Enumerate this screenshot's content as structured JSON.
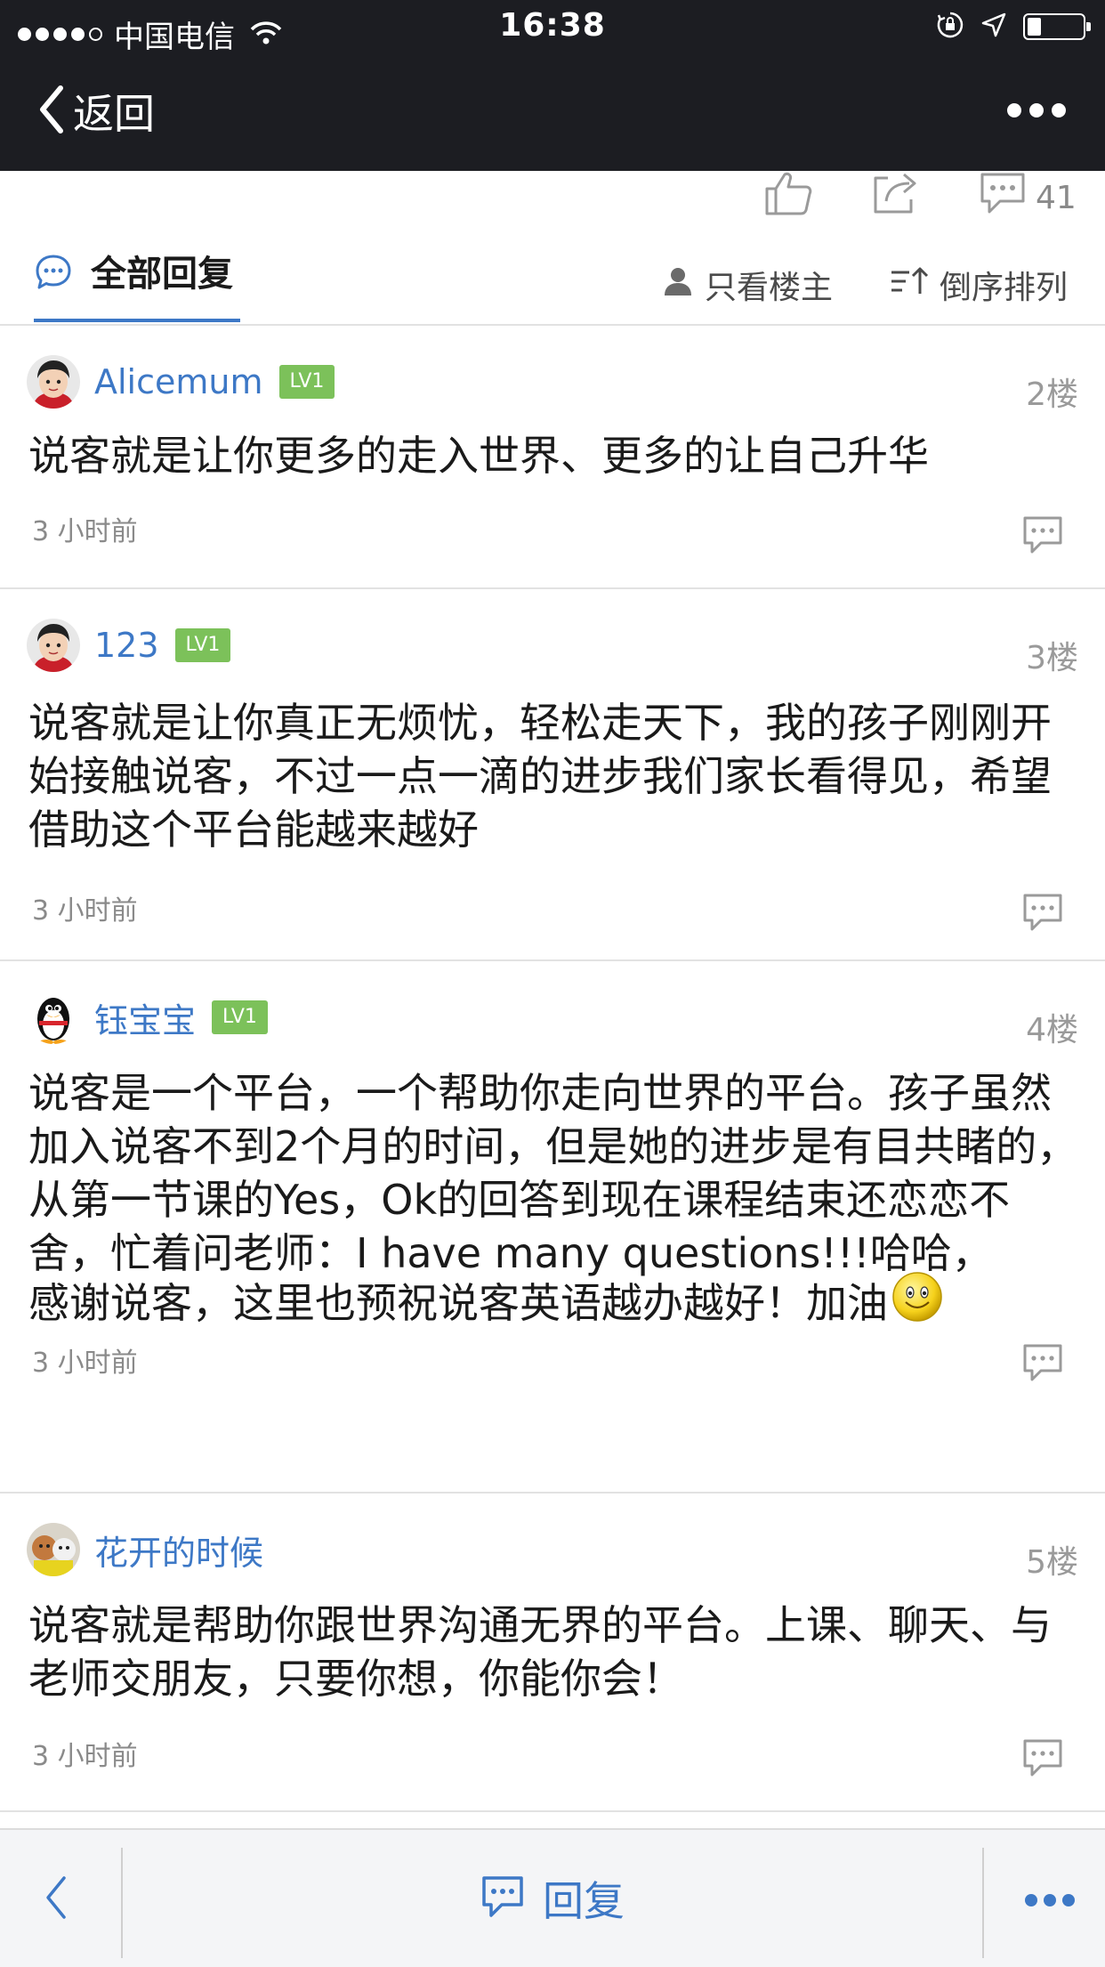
{
  "status_bar": {
    "carrier": "中国电信",
    "time": "16:38",
    "battery_level": 0.24
  },
  "nav": {
    "back_label": "返回",
    "more_icon": "more-dots-icon"
  },
  "actions": {
    "comment_count": "41"
  },
  "tabs": {
    "all_replies": "全部回复",
    "owner_only": "只看楼主",
    "reverse_order": "倒序排列"
  },
  "comments": [
    {
      "user": "Alicemum",
      "level": "LV1",
      "floor": "2楼",
      "text": "说客就是让你更多的走入世界、更多的让自己升华",
      "time": "3 小时前"
    },
    {
      "user": "123",
      "level": "LV1",
      "floor": "3楼",
      "text": "说客就是让你真正无烦忧，轻松走天下，我的孩子刚刚开始接触说客，不过一点一滴的进步我们家长看得见，希望借助这个平台能越来越好",
      "time": "3 小时前"
    },
    {
      "user": "钰宝宝",
      "level": "LV1",
      "floor": "4楼",
      "text": "说客是一个平台，一个帮助你走向世界的平台。孩子虽然加入说客不到2个月的时间，但是她的进步是有目共睹的，从第一节课的Yes，Ok的回答到现在课程结束还恋恋不舍，忙着问老师：I have many questions!!!哈哈，",
      "text2": "感谢说客，这里也预祝说客英语越办越好！加油",
      "time": "3 小时前"
    },
    {
      "user": "花开的时候",
      "floor": "5楼",
      "text": "说客就是帮助你跟世界沟通无界的平台。上课、聊天、与老师交朋友，只要你想，你能你会！",
      "time": "3 小时前"
    }
  ],
  "bottom_bar": {
    "reply_label": "回复"
  },
  "colors": {
    "accent": "#3d78c6",
    "header_bg": "#1c1d22",
    "badge": "#7cc15a"
  }
}
